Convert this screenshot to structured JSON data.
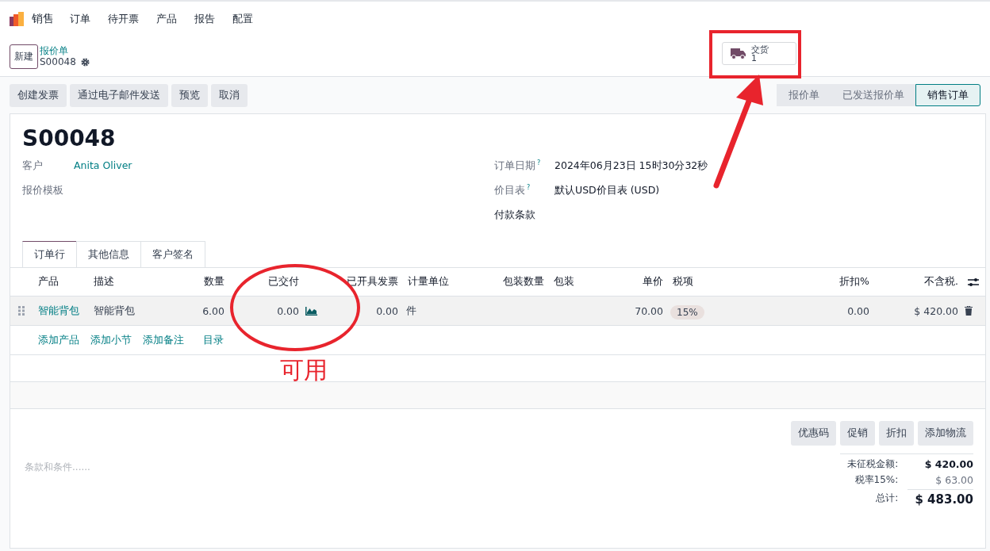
{
  "nav": {
    "app": "销售",
    "menu": [
      "订单",
      "待开票",
      "产品",
      "报告",
      "配置"
    ]
  },
  "control": {
    "new_button": "新建",
    "breadcrumb": "报价单",
    "record": "S00048",
    "stat_button": {
      "label": "交货",
      "value": "1"
    }
  },
  "actions": [
    "创建发票",
    "通过电子邮件发送",
    "预览",
    "取消"
  ],
  "statusbar": [
    {
      "label": "报价单",
      "selected": false
    },
    {
      "label": "已发送报价单",
      "selected": false
    },
    {
      "label": "销售订单",
      "selected": true
    }
  ],
  "form": {
    "title": "S00048",
    "left_fields": [
      {
        "label": "客户",
        "value": "Anita Oliver"
      },
      {
        "label": "报价模板"
      }
    ],
    "right_fields": [
      {
        "label": "订单日期",
        "help": "?",
        "value": "2024年06月23日 15时30分32秒"
      },
      {
        "label": "价目表",
        "help": "?",
        "value": "默认USD价目表 (USD)"
      },
      {
        "label": "付款条款"
      }
    ]
  },
  "tabs": [
    {
      "label": "订单行",
      "selected": true
    },
    {
      "label": "其他信息",
      "selected": false
    },
    {
      "label": "客户签名",
      "selected": false
    }
  ],
  "table": {
    "columns": [
      "产品",
      "描述",
      "数量",
      "已交付",
      "已开具发票",
      "计量单位",
      "包装数量",
      "包装",
      "单价",
      "税项",
      "折扣%",
      "不含税."
    ],
    "rows": [
      {
        "product": "智能背包",
        "description": "智能背包",
        "quantity": "6.00",
        "delivered": "0.00",
        "invoiced": "0.00",
        "uom": "件",
        "unit_price": "70.00",
        "taxes": [
          "15%"
        ],
        "discount": "0.00",
        "subtotal": "$ 420.00"
      }
    ],
    "add_links": [
      "添加产品",
      "添加小节",
      "添加备注",
      "目录"
    ]
  },
  "terms_placeholder": "条款和条件......",
  "footer_buttons": [
    "优惠码",
    "促销",
    "折扣",
    "添加物流"
  ],
  "totals": [
    {
      "label": "未征税金额:",
      "value": "$ 420.00",
      "kind": "strong"
    },
    {
      "label": "税率15%:",
      "value": "$ 63.00",
      "kind": "plain"
    },
    {
      "label": "总计:",
      "value": "$ 483.00",
      "kind": "total"
    }
  ],
  "annotation": {
    "text": "可用"
  }
}
